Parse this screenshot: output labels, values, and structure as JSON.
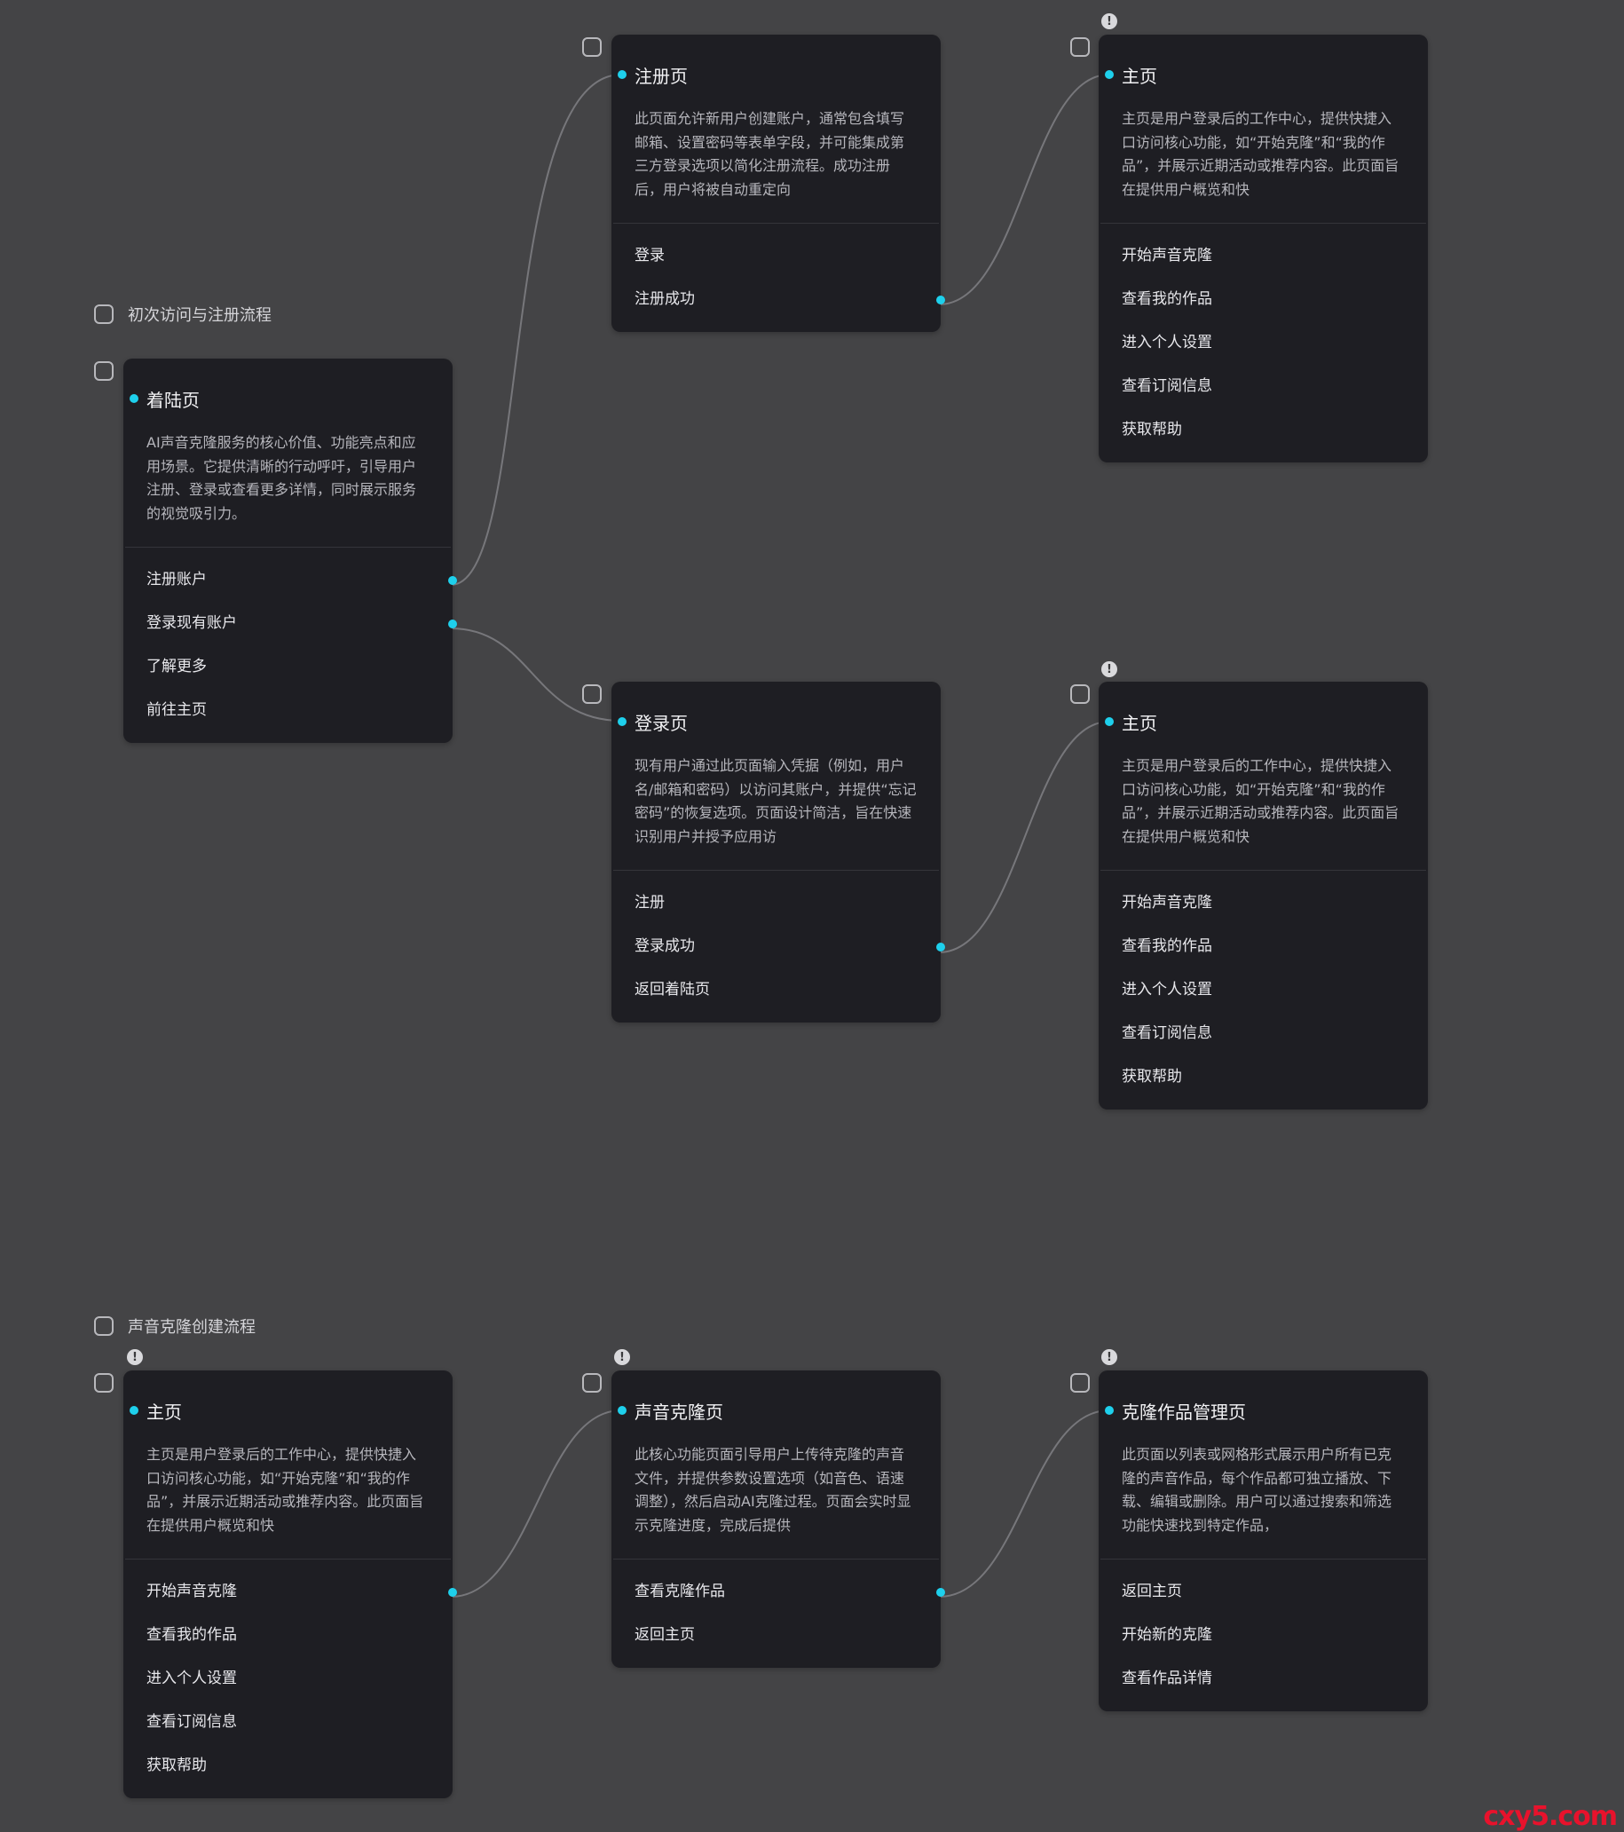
{
  "flows": [
    {
      "label": "初次访问与注册流程"
    },
    {
      "label": "声音克隆创建流程"
    }
  ],
  "cards": {
    "landing": {
      "title": "着陆页",
      "desc": "AI声音克隆服务的核心价值、功能亮点和应用场景。它提供清晰的行动呼吁，引导用户注册、登录或查看更多详情，同时展示服务的视觉吸引力。",
      "actions": [
        "注册账户",
        "登录现有账户",
        "了解更多",
        "前往主页"
      ]
    },
    "register": {
      "title": "注册页",
      "desc": "此页面允许新用户创建账户，通常包含填写邮箱、设置密码等表单字段，并可能集成第三方登录选项以简化注册流程。成功注册后，用户将被自动重定向",
      "actions": [
        "登录",
        "注册成功"
      ]
    },
    "home_a": {
      "title": "主页",
      "desc": "主页是用户登录后的工作中心，提供快捷入口访问核心功能，如“开始克隆”和“我的作品”，并展示近期活动或推荐内容。此页面旨在提供用户概览和快",
      "actions": [
        "开始声音克隆",
        "查看我的作品",
        "进入个人设置",
        "查看订阅信息",
        "获取帮助"
      ]
    },
    "login": {
      "title": "登录页",
      "desc": "现有用户通过此页面输入凭据（例如，用户名/邮箱和密码）以访问其账户，并提供“忘记密码”的恢复选项。页面设计简洁，旨在快速识别用户并授予应用访",
      "actions": [
        "注册",
        "登录成功",
        "返回着陆页"
      ]
    },
    "home_b": {
      "title": "主页",
      "desc": "主页是用户登录后的工作中心，提供快捷入口访问核心功能，如“开始克隆”和“我的作品”，并展示近期活动或推荐内容。此页面旨在提供用户概览和快",
      "actions": [
        "开始声音克隆",
        "查看我的作品",
        "进入个人设置",
        "查看订阅信息",
        "获取帮助"
      ]
    },
    "home_c": {
      "title": "主页",
      "desc": "主页是用户登录后的工作中心，提供快捷入口访问核心功能，如“开始克隆”和“我的作品”，并展示近期活动或推荐内容。此页面旨在提供用户概览和快",
      "actions": [
        "开始声音克隆",
        "查看我的作品",
        "进入个人设置",
        "查看订阅信息",
        "获取帮助"
      ]
    },
    "clone": {
      "title": "声音克隆页",
      "desc": "此核心功能页面引导用户上传待克隆的声音文件，并提供参数设置选项（如音色、语速调整），然后启动AI克隆过程。页面会实时显示克隆进度，完成后提供",
      "actions": [
        "查看克隆作品",
        "返回主页"
      ]
    },
    "works": {
      "title": "克隆作品管理页",
      "desc": "此页面以列表或网格形式展示用户所有已克隆的声音作品，每个作品都可独立播放、下载、编辑或删除。用户可以通过搜索和筛选功能快速找到特定作品，",
      "actions": [
        "返回主页",
        "开始新的克隆",
        "查看作品详情"
      ]
    }
  },
  "watermark": "cxy5.com",
  "colors": {
    "background": "#444446",
    "card": "#1e1e23",
    "accent": "#1ed0ec",
    "edge": "#77777b"
  }
}
